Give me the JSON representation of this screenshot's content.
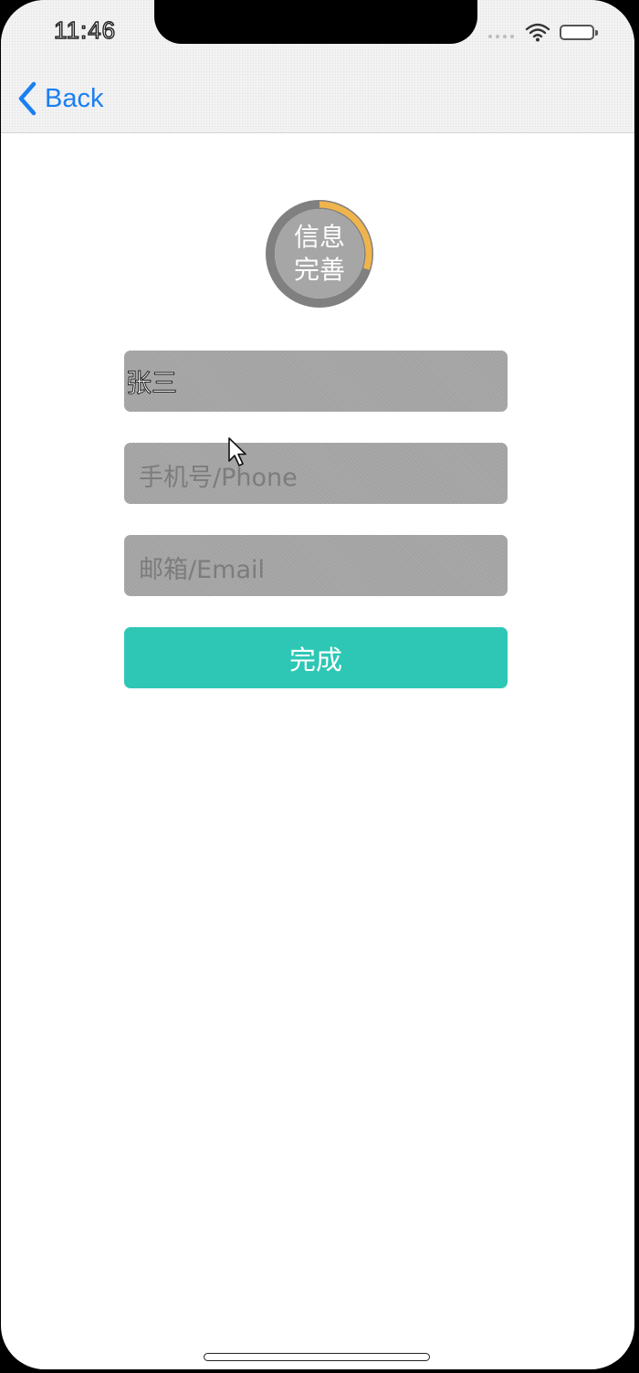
{
  "status_bar": {
    "time": "11:46"
  },
  "navbar": {
    "back_label": "Back"
  },
  "progress": {
    "line1": "信息",
    "line2": "完善",
    "fraction": 0.3,
    "track_color": "#808080",
    "fill_color": "#f0b44c",
    "center_color": "#a6a6a6"
  },
  "form": {
    "name_value": "张三",
    "phone_placeholder": "手机号/Phone",
    "email_placeholder": "邮箱/Email",
    "submit_label": "完成"
  },
  "colors": {
    "accent": "#1a7ff2",
    "submit": "#2ec7b5",
    "field_bg": "#a8a8a8"
  }
}
